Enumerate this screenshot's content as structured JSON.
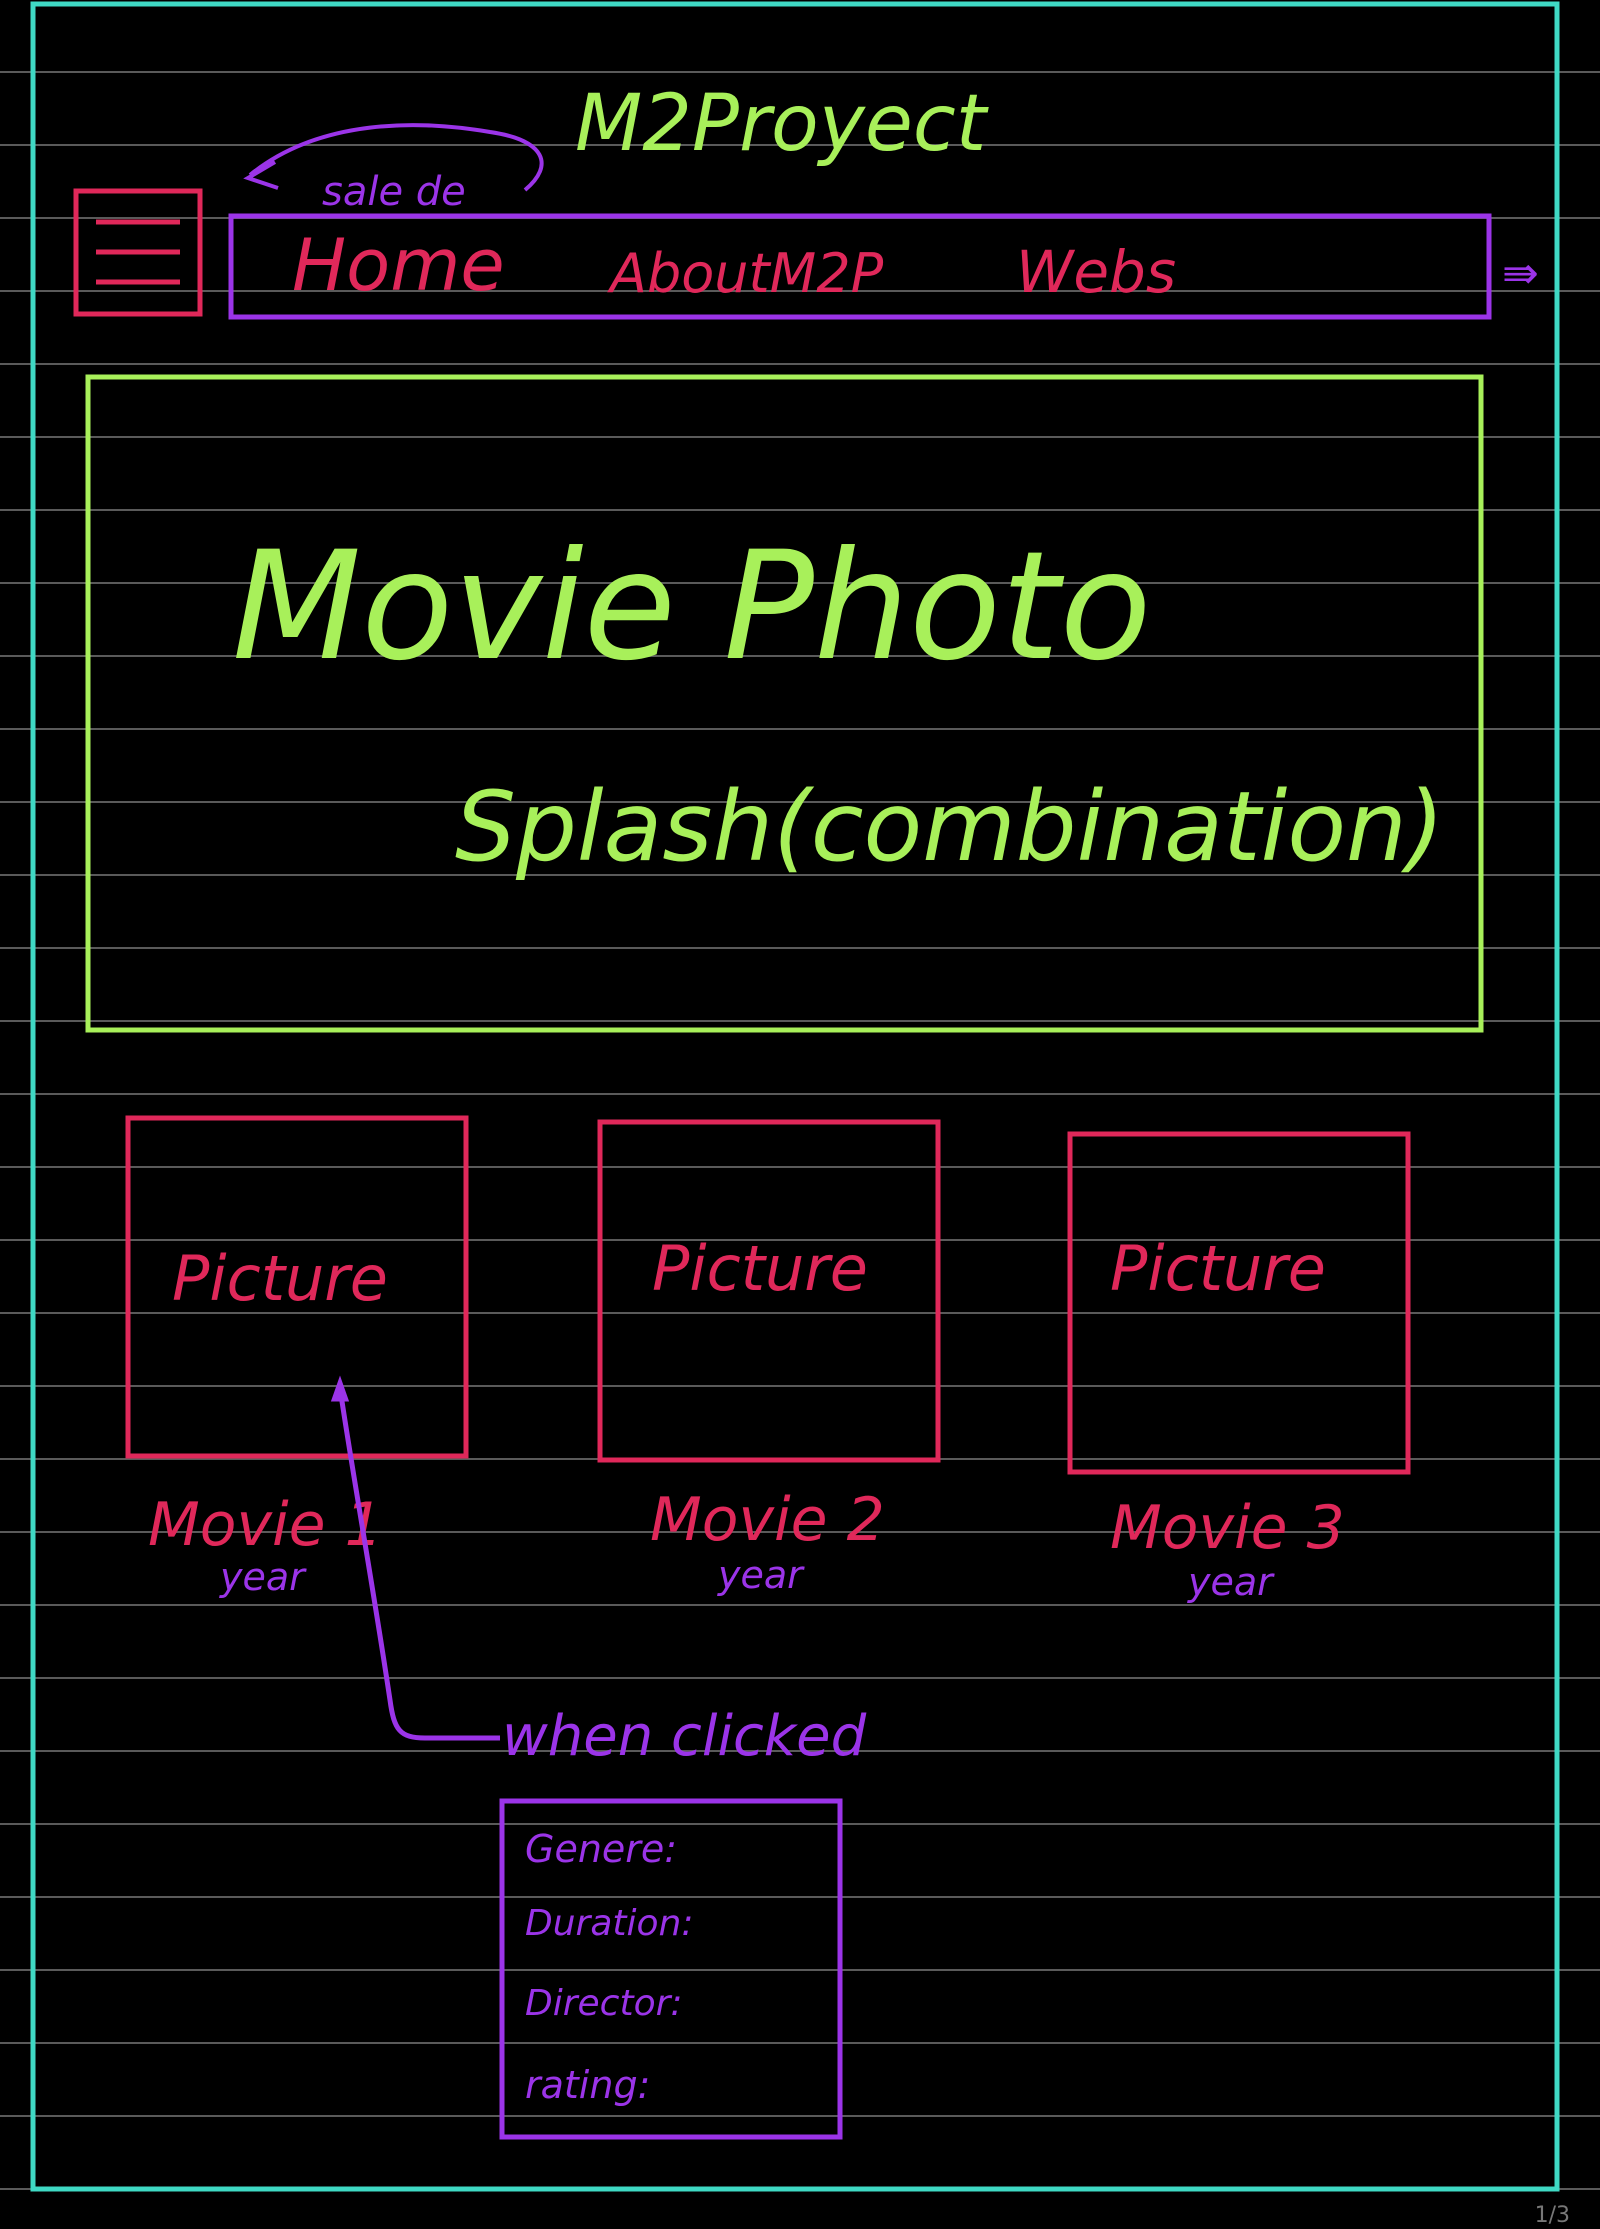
{
  "project_title": "M2Proyect",
  "menu_note": "sale de",
  "nav": {
    "items": [
      "Home",
      "AboutM2P",
      "Webs"
    ],
    "overflow_marker": "⇛"
  },
  "hero": {
    "line1": "Movie Photo",
    "line2": "Splash(combination)"
  },
  "movies": [
    {
      "picture": "Picture",
      "name": "Movie 1",
      "year": "year"
    },
    {
      "picture": "Picture",
      "name": "Movie 2",
      "year": "year"
    },
    {
      "picture": "Picture",
      "name": "Movie 3",
      "year": "year"
    }
  ],
  "click_note": "when clicked",
  "details": {
    "fields": [
      "Genere:",
      "Duration:",
      "Director:",
      "rating:"
    ]
  },
  "page_number": "1/3",
  "colors": {
    "frame": "#3fd9c4",
    "title": "#a8f05a",
    "menu": "#e0285a",
    "nav_border": "#9b34e8",
    "nav_text": "#e0285a",
    "hero": "#a8f05a",
    "card": "#e0285a",
    "annotation": "#9b34e8"
  }
}
